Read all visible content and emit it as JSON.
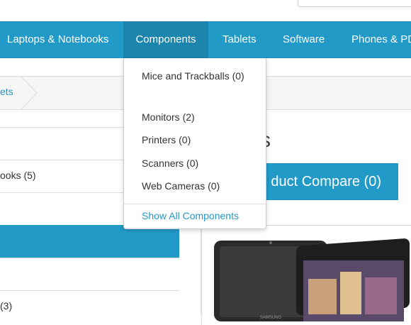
{
  "nav": {
    "items": [
      {
        "label": "Laptops & Notebooks"
      },
      {
        "label": "Components"
      },
      {
        "label": "Tablets"
      },
      {
        "label": "Software"
      },
      {
        "label": "Phones & PD"
      }
    ]
  },
  "dropdown": {
    "items": [
      {
        "label": "Mice and Trackballs (0)"
      },
      {
        "label": "Monitors (2)"
      },
      {
        "label": "Printers (0)"
      },
      {
        "label": "Scanners (0)"
      },
      {
        "label": "Web Cameras (0)"
      }
    ],
    "show_all": "Show All Components"
  },
  "breadcrumb": {
    "last": "ets"
  },
  "sidebar": {
    "items": [
      {
        "label": ""
      },
      {
        "label": "ooks (5)"
      },
      {
        "label": ""
      },
      {
        "label": ""
      },
      {
        "label": ""
      },
      {
        "label": "(3)"
      }
    ]
  },
  "main": {
    "title": "s",
    "compare_label": "duct Compare (0)",
    "product_brand": "SAMSUNG"
  },
  "colors": {
    "accent": "#229ac8",
    "active": "#1b85ad"
  }
}
